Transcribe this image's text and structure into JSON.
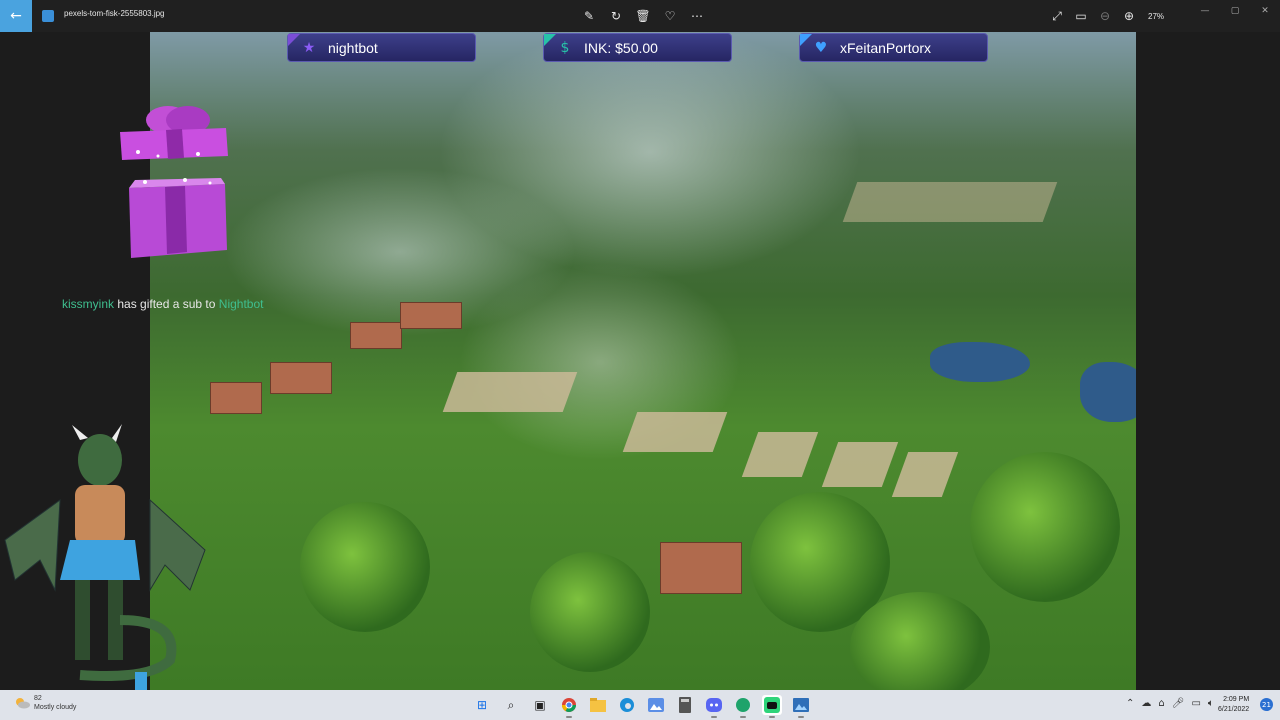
{
  "titlebar": {
    "back_label": "←",
    "file_name": "pexels-tom-fisk-2555803.jpg",
    "zoom": "27%"
  },
  "icons": {
    "edit": "edit-icon",
    "rotate": "rotate-icon",
    "delete": "trash-icon",
    "favorite": "heart-icon",
    "more": "more-icon",
    "fullscreen": "expand-icon",
    "aspect": "fit-icon",
    "zoom_out": "zoom-out-icon",
    "zoom_in": "zoom-in-icon"
  },
  "overlay": {
    "alerts": [
      {
        "text": "nightbot",
        "icon": "star-icon",
        "color": "#7a4dd6"
      },
      {
        "text": "INK: $50.00",
        "icon": "dollar-icon",
        "color": "#27c2a8"
      },
      {
        "text": "xFeitanPortorx",
        "icon": "heart-icon",
        "color": "#3fa0ff"
      }
    ],
    "sub_message": {
      "gifter": "kissmyink",
      "middle": "has gifted a sub to",
      "recipient": "Nightbot"
    }
  },
  "taskbar": {
    "weather_temp": "82",
    "weather_desc": "Mostly cloudy",
    "time": "2:09 PM",
    "date": "6/21/2022",
    "notifications": "21"
  },
  "colors": {
    "accent": "#4aa3df",
    "alert_bg": "#2d2d70",
    "sub_user": "#3fbf8f"
  }
}
